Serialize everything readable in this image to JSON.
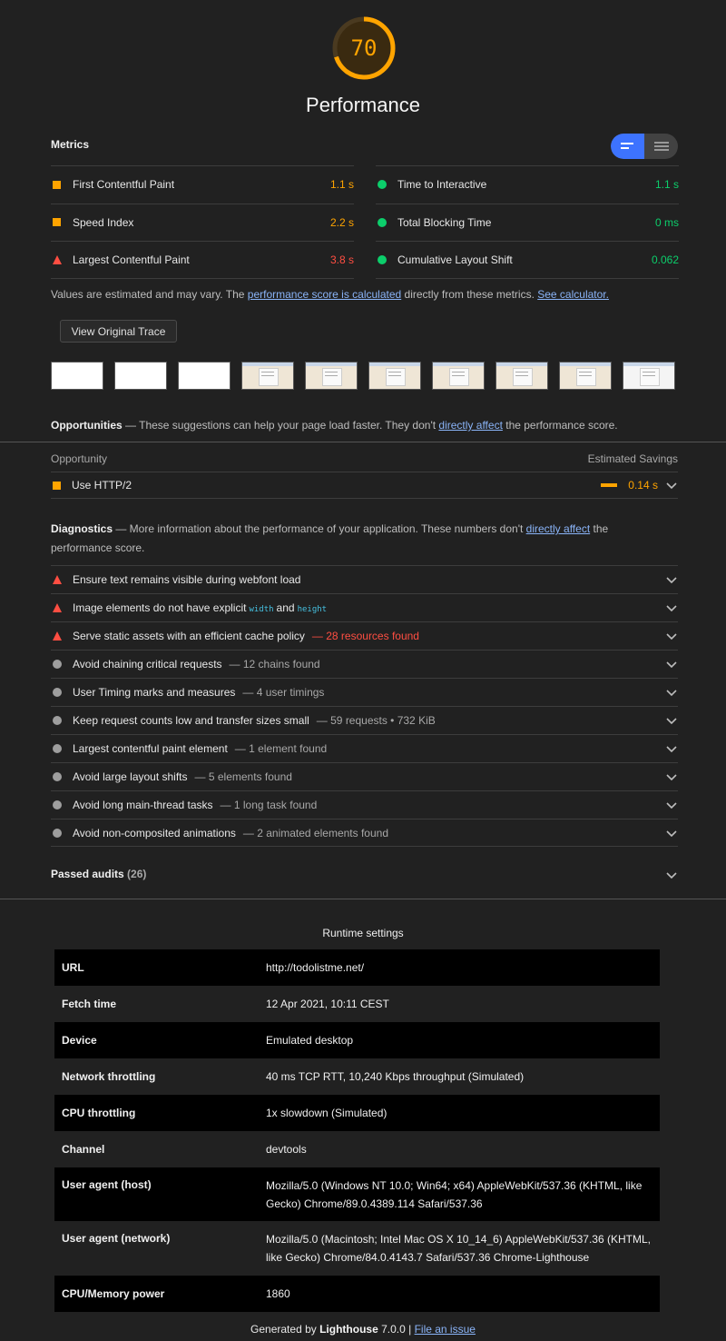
{
  "score": {
    "value": "70",
    "fraction": 0.7,
    "title": "Performance",
    "color": "#ffa400"
  },
  "metrics": {
    "title": "Metrics",
    "left": [
      {
        "icon": "orange-square-icon",
        "label": "First Contentful Paint",
        "value": "1.1 s",
        "color": "orange"
      },
      {
        "icon": "orange-square-icon",
        "label": "Speed Index",
        "value": "2.2 s",
        "color": "orange"
      },
      {
        "icon": "red-triangle-icon",
        "label": "Largest Contentful Paint",
        "value": "3.8 s",
        "color": "red"
      }
    ],
    "right": [
      {
        "icon": "green-circle-icon",
        "label": "Time to Interactive",
        "value": "1.1 s",
        "color": "green"
      },
      {
        "icon": "green-circle-icon",
        "label": "Total Blocking Time",
        "value": "0 ms",
        "color": "green"
      },
      {
        "icon": "green-circle-icon",
        "label": "Cumulative Layout Shift",
        "value": "0.062",
        "color": "green"
      }
    ],
    "note_prefix": "Values are estimated and may vary. The ",
    "note_link1": "performance score is calculated",
    "note_middle": " directly from these metrics. ",
    "note_link2": "See calculator.",
    "trace_button": "View Original Trace"
  },
  "opportunities": {
    "title": "Opportunities",
    "desc_prefix": " — These suggestions can help your page load faster. They don't ",
    "desc_link": "directly affect",
    "desc_suffix": " the performance score.",
    "col_left": "Opportunity",
    "col_right": "Estimated Savings",
    "items": [
      {
        "label": "Use HTTP/2",
        "value": "0.14 s",
        "fraction": 0.14
      }
    ]
  },
  "diagnostics": {
    "title": "Diagnostics",
    "desc_prefix": " — More information about the performance of your application. These numbers don't ",
    "desc_link": "directly affect",
    "desc_suffix": " the performance score.",
    "items": [
      {
        "icon": "red-triangle-icon",
        "label": "Ensure text remains visible during webfont load",
        "detail": ""
      },
      {
        "icon": "red-triangle-icon",
        "label": "Image elements do not have explicit",
        "code1": "width",
        "and": "and",
        "code2": "height",
        "detail": ""
      },
      {
        "icon": "red-triangle-icon",
        "label": "Serve static assets with an efficient cache policy",
        "detail": "— 28 resources found",
        "red": true
      },
      {
        "icon": "grey-circle-icon",
        "label": "Avoid chaining critical requests",
        "detail": "— 12 chains found"
      },
      {
        "icon": "grey-circle-icon",
        "label": "User Timing marks and measures",
        "detail": "— 4 user timings"
      },
      {
        "icon": "grey-circle-icon",
        "label": "Keep request counts low and transfer sizes small",
        "detail": "— 59 requests • 732 KiB"
      },
      {
        "icon": "grey-circle-icon",
        "label": "Largest contentful paint element",
        "detail": "— 1 element found"
      },
      {
        "icon": "grey-circle-icon",
        "label": "Avoid large layout shifts",
        "detail": "— 5 elements found"
      },
      {
        "icon": "grey-circle-icon",
        "label": "Avoid long main-thread tasks",
        "detail": "— 1 long task found"
      },
      {
        "icon": "grey-circle-icon",
        "label": "Avoid non-composited animations",
        "detail": "— 2 animated elements found"
      }
    ]
  },
  "passed": {
    "label": "Passed audits",
    "count": "(26)"
  },
  "runtime": {
    "title": "Runtime settings",
    "rows": [
      {
        "key": "URL",
        "value": "http://todolistme.net/"
      },
      {
        "key": "Fetch time",
        "value": "12 Apr 2021, 10:11 CEST"
      },
      {
        "key": "Device",
        "value": "Emulated desktop"
      },
      {
        "key": "Network throttling",
        "value": "40 ms TCP RTT, 10,240 Kbps throughput (Simulated)"
      },
      {
        "key": "CPU throttling",
        "value": "1x slowdown (Simulated)"
      },
      {
        "key": "Channel",
        "value": "devtools"
      },
      {
        "key": "User agent (host)",
        "value": "Mozilla/5.0 (Windows NT 10.0; Win64; x64) AppleWebKit/537.36 (KHTML, like Gecko) Chrome/89.0.4389.114 Safari/537.36"
      },
      {
        "key": "User agent (network)",
        "value": "Mozilla/5.0 (Macintosh; Intel Mac OS X 10_14_6) AppleWebKit/537.36 (KHTML, like Gecko) Chrome/84.0.4143.7 Safari/537.36 Chrome-Lighthouse"
      },
      {
        "key": "CPU/Memory power",
        "value": "1860"
      }
    ]
  },
  "footer": {
    "prefix": "Generated by ",
    "brand": "Lighthouse",
    "version": " 7.0.0 | ",
    "link": "File an issue"
  }
}
